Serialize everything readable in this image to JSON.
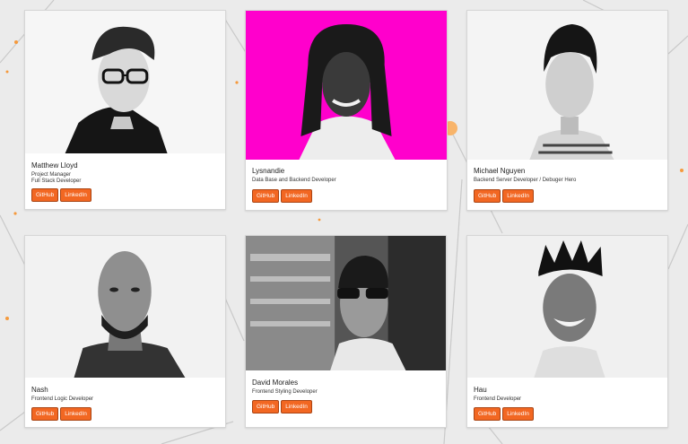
{
  "accent_color": "#f26722",
  "team": [
    {
      "name": "Matthew Lloyd",
      "roles": [
        "Project Manager",
        "Full Stack Developer"
      ],
      "github_label": "GitHub",
      "linkedin_label": "LinkedIn",
      "photo_bg": "#f6f6f6"
    },
    {
      "name": "Lysnandie",
      "roles": [
        "Data Base and Backend Developer"
      ],
      "github_label": "GitHub",
      "linkedin_label": "LinkedIn",
      "photo_bg": "#ff00cc"
    },
    {
      "name": "Michael Nguyen",
      "roles": [
        "Backend Server Developer / Debuger Hero"
      ],
      "github_label": "GitHub",
      "linkedin_label": "LinkedIn",
      "photo_bg": "#f4f4f4"
    },
    {
      "name": "Nash",
      "roles": [
        "Frontend Logic Developer"
      ],
      "github_label": "GitHub",
      "linkedin_label": "LinkedIn",
      "photo_bg": "#f2f2f2"
    },
    {
      "name": "David Morales",
      "roles": [
        "Frontend Styling Developer"
      ],
      "github_label": "GitHub",
      "linkedin_label": "LinkedIn",
      "photo_bg": "#555555"
    },
    {
      "name": "Hau",
      "roles": [
        "Frontend Developer"
      ],
      "github_label": "GitHub",
      "linkedin_label": "LinkedIn",
      "photo_bg": "#f0f0f0"
    }
  ]
}
